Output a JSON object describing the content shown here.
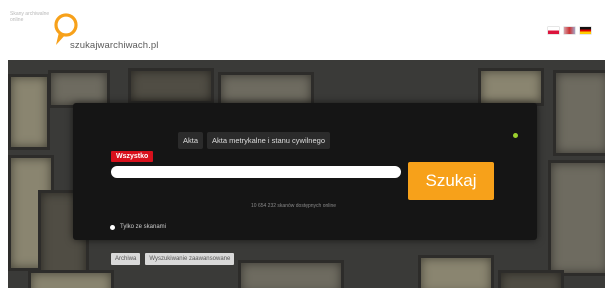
{
  "header": {
    "tagline": "Skany archiwalne online",
    "brand": "szukajwarchiwach.pl",
    "languages": [
      {
        "code": "pl",
        "icon": "flag-pl-icon"
      },
      {
        "code": "en",
        "icon": "flag-en-icon"
      },
      {
        "code": "de",
        "icon": "flag-de-icon"
      }
    ],
    "logo_color": "#f7a11a"
  },
  "search": {
    "tabs": [
      {
        "label": "Akta"
      },
      {
        "label": "Akta metrykalne i stanu cywilnego"
      }
    ],
    "scope_label": "Wszystko",
    "query_value": "",
    "query_placeholder": "",
    "submit_label": "Szukaj",
    "count_text": "10 654 232 skanów dostępnych online",
    "checkbox_label": "Tylko ze skanami",
    "status_color": "#9bd02d",
    "accent_color": "#f7a11a",
    "scope_color": "#d8101c"
  },
  "footer_buttons": [
    {
      "label": "Archiwa"
    },
    {
      "label": "Wyszukiwanie zaawansowane"
    }
  ]
}
